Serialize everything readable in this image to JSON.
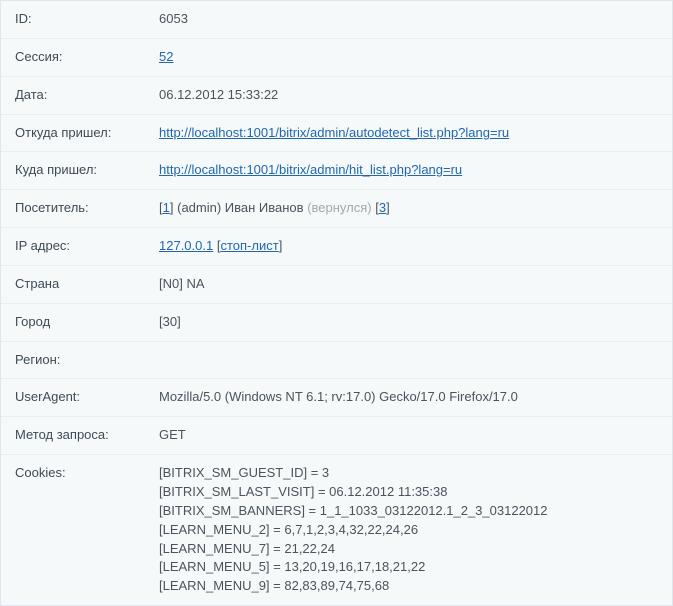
{
  "rows": {
    "id": {
      "label": "ID:",
      "value": "6053"
    },
    "session": {
      "label": "Сессия:",
      "link": "52"
    },
    "date": {
      "label": "Дата:",
      "value": "06.12.2012 15:33:22"
    },
    "from": {
      "label": "Откуда пришел:",
      "link": "http://localhost:1001/bitrix/admin/autodetect_list.php?lang=ru"
    },
    "to": {
      "label": "Куда пришел:",
      "link": "http://localhost:1001/bitrix/admin/hit_list.php?lang=ru"
    },
    "visitor": {
      "label": "Посетитель:",
      "id_link": "1",
      "user": "(admin) Иван Иванов",
      "returned": "(вернулся)",
      "count_link": "3"
    },
    "ip": {
      "label": "IP адрес:",
      "ip_link": "127.0.0.1",
      "stoplist": "стоп-лист"
    },
    "country": {
      "label": "Страна",
      "value": "[N0] NA"
    },
    "city": {
      "label": "Город",
      "value": "[30]"
    },
    "region": {
      "label": "Регион:",
      "value": ""
    },
    "ua": {
      "label": "UserAgent:",
      "value": "Mozilla/5.0 (Windows NT 6.1; rv:17.0) Gecko/17.0 Firefox/17.0"
    },
    "method": {
      "label": "Метод запроса:",
      "value": "GET"
    },
    "cookies": {
      "label": "Cookies:",
      "lines": [
        "[BITRIX_SM_GUEST_ID] = 3",
        "[BITRIX_SM_LAST_VISIT] = 06.12.2012 11:35:38",
        "[BITRIX_SM_BANNERS] = 1_1_1033_03122012.1_2_3_03122012",
        "[LEARN_MENU_2] = 6,7,1,2,3,4,32,22,24,26",
        "[LEARN_MENU_7] = 21,22,24",
        "[LEARN_MENU_5] = 13,20,19,16,17,18,21,22",
        "[LEARN_MENU_9] = 82,83,89,74,75,68"
      ]
    }
  }
}
